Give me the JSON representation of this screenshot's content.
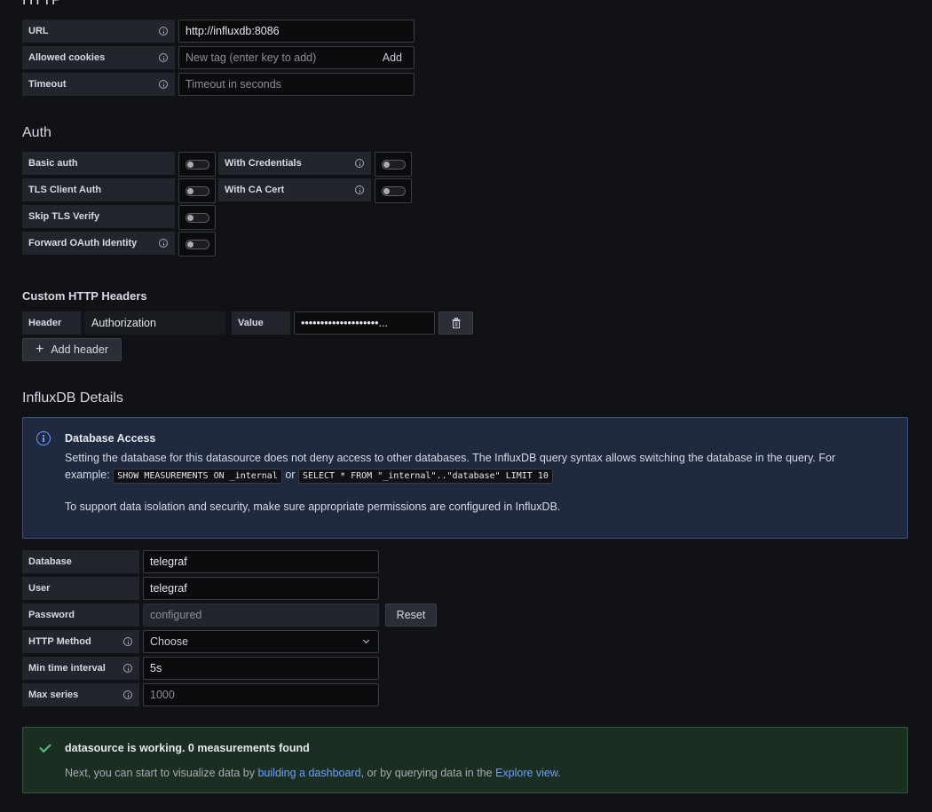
{
  "http": {
    "title": "HTTP",
    "url_label": "URL",
    "url_value": "http://influxdb:8086",
    "cookies_label": "Allowed cookies",
    "cookies_placeholder": "New tag (enter key to add)",
    "cookies_add": "Add",
    "timeout_label": "Timeout",
    "timeout_placeholder": "Timeout in seconds"
  },
  "auth": {
    "title": "Auth",
    "basic_auth": "Basic auth",
    "with_credentials": "With Credentials",
    "tls_client_auth": "TLS Client Auth",
    "with_ca_cert": "With CA Cert",
    "skip_tls_verify": "Skip TLS Verify",
    "forward_oauth": "Forward OAuth Identity"
  },
  "custom_headers": {
    "title": "Custom HTTP Headers",
    "header_label": "Header",
    "header_value": "Authorization",
    "value_label": "Value",
    "value_masked": "••••••••••••••••••••...",
    "add_header": "Add header"
  },
  "influx": {
    "title": "InfluxDB Details",
    "alert_title": "Database Access",
    "alert_line1": "Setting the database for this datasource does not deny access to other databases. The InfluxDB query syntax allows switching the database in the query. For",
    "alert_example": "example:",
    "alert_code1": "SHOW MEASUREMENTS ON _internal",
    "alert_or": "or",
    "alert_code2": "SELECT * FROM \"_internal\"..\"database\" LIMIT 10",
    "alert_line3": "To support data isolation and security, make sure appropriate permissions are configured in InfluxDB.",
    "database_label": "Database",
    "database_value": "telegraf",
    "user_label": "User",
    "user_value": "telegraf",
    "password_label": "Password",
    "password_value": "configured",
    "reset": "Reset",
    "method_label": "HTTP Method",
    "method_value": "Choose",
    "min_interval_label": "Min time interval",
    "min_interval_value": "5s",
    "max_series_label": "Max series",
    "max_series_placeholder": "1000"
  },
  "status": {
    "title": "datasource is working. 0 measurements found",
    "text_before": "Next, you can start to visualize data by",
    "link1": "building a dashboard",
    "text_middle": ", or by querying data in the",
    "link2": "Explore view",
    "text_after": "."
  }
}
